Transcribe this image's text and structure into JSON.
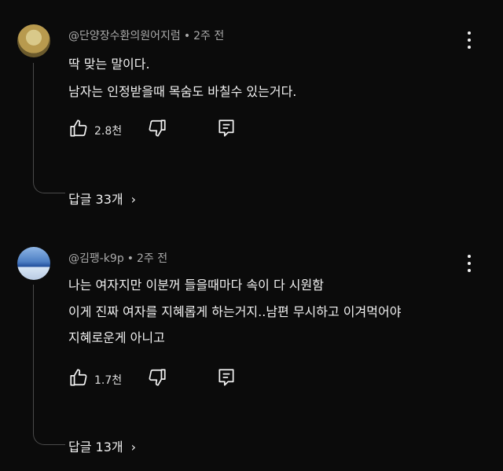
{
  "comments": [
    {
      "author": "@단양장수환의원어지럼",
      "time": "2주 전",
      "lines": [
        "딱 맞는 말이다.",
        "남자는 인정받을때 목숨도 바칠수 있는거다."
      ],
      "likes": "2.8천",
      "replies": "답글 33개"
    },
    {
      "author": "@김팽-k9p",
      "time": "2주 전",
      "lines": [
        "나는 여자지만 이분꺼 들을때마다 속이 다 시원함",
        "이게 진짜 여자를 지혜롭게 하는거지..남편 무시하고 이겨먹어야",
        "지혜로운게 아니고"
      ],
      "likes": "1.7천",
      "replies": "답글 13개"
    }
  ],
  "separator_dot": "•",
  "chevron": "›"
}
